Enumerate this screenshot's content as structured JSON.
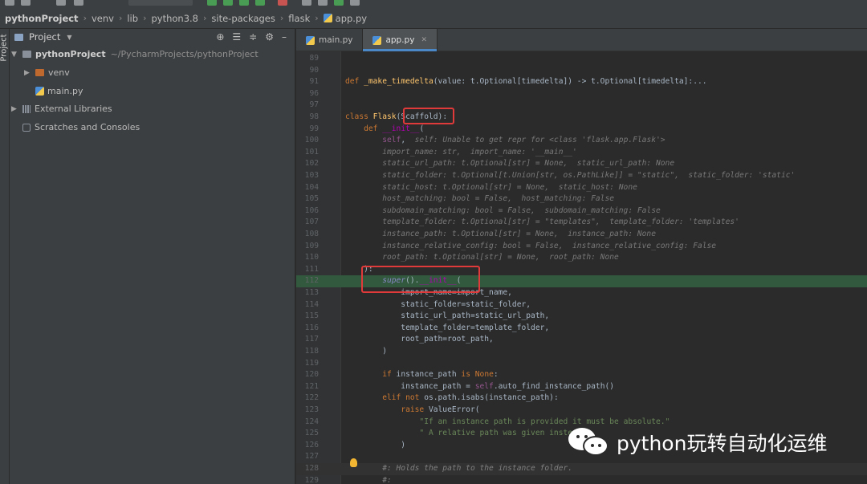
{
  "breadcrumb": [
    "pythonProject",
    "venv",
    "lib",
    "python3.8",
    "site-packages",
    "flask",
    "app.py"
  ],
  "project_panel": {
    "title": "Project",
    "tree": {
      "root_name": "pythonProject",
      "root_path": "~/PycharmProjects/pythonProject",
      "venv": "venv",
      "main_file": "main.py",
      "external_libraries": "External Libraries",
      "scratches": "Scratches and Consoles"
    }
  },
  "tool_strip_label": "Project",
  "tabs": [
    {
      "label": "main.py",
      "active": false
    },
    {
      "label": "app.py",
      "active": true
    }
  ],
  "editor": {
    "lines": [
      {
        "n": "89",
        "text": ""
      },
      {
        "n": "90",
        "text": ""
      },
      {
        "n": "91",
        "text": "def _make_timedelta(value: t.Optional[timedelta]) -> t.Optional[timedelta]:..."
      },
      {
        "n": "96",
        "text": ""
      },
      {
        "n": "97",
        "text": ""
      },
      {
        "n": "98",
        "text": "class Flask(Scaffold):"
      },
      {
        "n": "99",
        "text": "    def __init__("
      },
      {
        "n": "100",
        "text": "        self,  self: Unable to get repr for <class 'flask.app.Flask'>"
      },
      {
        "n": "101",
        "text": "        import_name: str,  import_name: '__main__'"
      },
      {
        "n": "102",
        "text": "        static_url_path: t.Optional[str] = None,  static_url_path: None"
      },
      {
        "n": "103",
        "text": "        static_folder: t.Optional[t.Union[str, os.PathLike]] = \"static\",  static_folder: 'static'"
      },
      {
        "n": "104",
        "text": "        static_host: t.Optional[str] = None,  static_host: None"
      },
      {
        "n": "105",
        "text": "        host_matching: bool = False,  host_matching: False"
      },
      {
        "n": "106",
        "text": "        subdomain_matching: bool = False,  subdomain_matching: False"
      },
      {
        "n": "107",
        "text": "        template_folder: t.Optional[str] = \"templates\",  template_folder: 'templates'"
      },
      {
        "n": "108",
        "text": "        instance_path: t.Optional[str] = None,  instance_path: None"
      },
      {
        "n": "109",
        "text": "        instance_relative_config: bool = False,  instance_relative_config: False"
      },
      {
        "n": "110",
        "text": "        root_path: t.Optional[str] = None,  root_path: None"
      },
      {
        "n": "111",
        "text": "    ):"
      },
      {
        "n": "112",
        "text": "        super().__init__("
      },
      {
        "n": "113",
        "text": "            import_name=import_name,"
      },
      {
        "n": "114",
        "text": "            static_folder=static_folder,"
      },
      {
        "n": "115",
        "text": "            static_url_path=static_url_path,"
      },
      {
        "n": "116",
        "text": "            template_folder=template_folder,"
      },
      {
        "n": "117",
        "text": "            root_path=root_path,"
      },
      {
        "n": "118",
        "text": "        )"
      },
      {
        "n": "119",
        "text": ""
      },
      {
        "n": "120",
        "text": "        if instance_path is None:"
      },
      {
        "n": "121",
        "text": "            instance_path = self.auto_find_instance_path()"
      },
      {
        "n": "122",
        "text": "        elif not os.path.isabs(instance_path):"
      },
      {
        "n": "123",
        "text": "            raise ValueError("
      },
      {
        "n": "124",
        "text": "                \"If an instance path is provided it must be absolute.\""
      },
      {
        "n": "125",
        "text": "                \" A relative path was given inste"
      },
      {
        "n": "126",
        "text": "            )"
      },
      {
        "n": "127",
        "text": ""
      },
      {
        "n": "128",
        "text": "        #: Holds the path to the instance folder."
      },
      {
        "n": "129",
        "text": "        #:"
      }
    ]
  },
  "watermark": "python玩转自动化运维",
  "colors": {
    "background": "#2b2b2b",
    "panel": "#3c3f41",
    "highlight_line": "#32593d",
    "annotation_box": "#e03a3a",
    "keyword": "#cc7832",
    "function": "#ffc66d",
    "string": "#6a8759",
    "self": "#94558d"
  }
}
